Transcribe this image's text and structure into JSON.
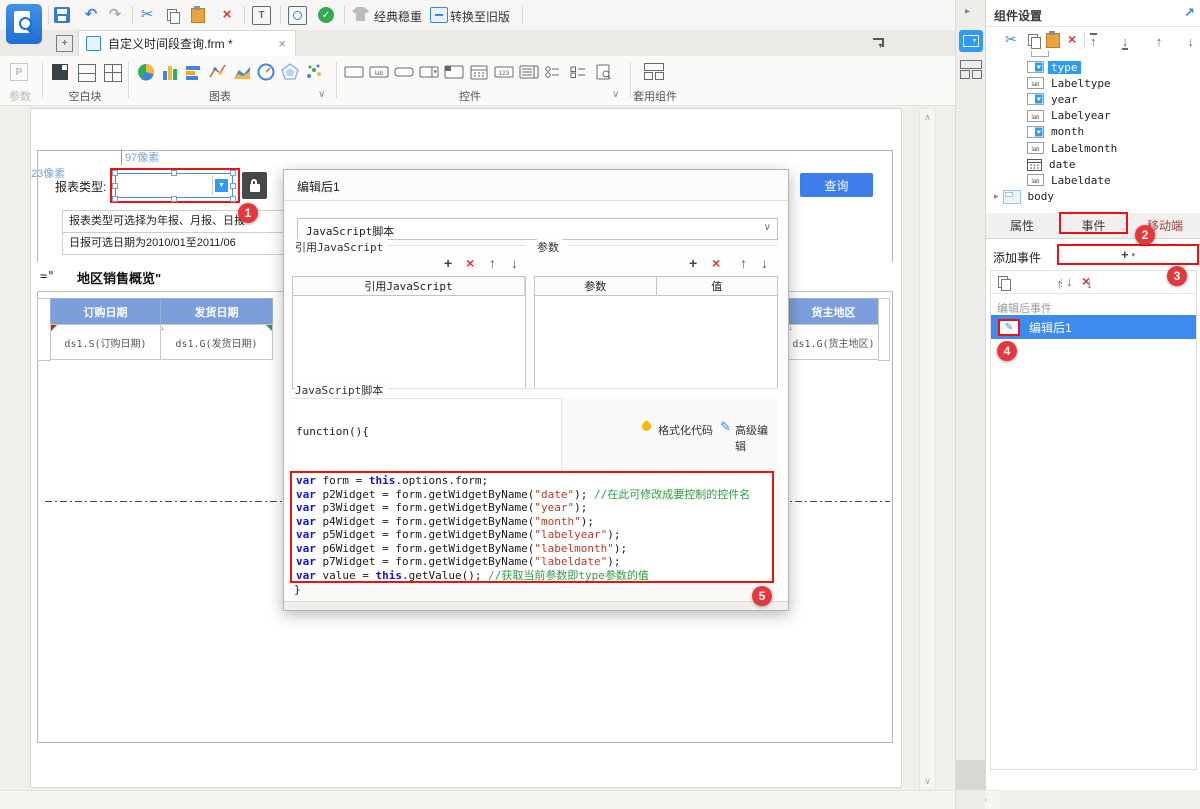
{
  "colors": {
    "accent_blue": "#3d7eea",
    "selection_blue": "#2e9cf4",
    "badge_red": "#e8363d",
    "outline_red": "#ee1111",
    "table_header_blue": "#7c9fdb"
  },
  "glyphs": {
    "undo": "↶",
    "redo": "↷",
    "cut": "✂",
    "close": "×",
    "delete": "×",
    "check": "✓",
    "chevron": "∨",
    "caret_down": "▾",
    "caret_right": "▸",
    "arrow_up": "↑",
    "arrow_down": "↓",
    "plus": "+",
    "pencil": "✎",
    "expand": "↗",
    "combo_caret": "▼",
    "t_letter": "T",
    "p_letter": "P",
    "gt": "›",
    "angle_up": "∧",
    "angle_down": "∨",
    "dots": "⋮"
  },
  "topbar": {
    "classic_label": "经典稳重",
    "convert_label": "转换至旧版"
  },
  "tabbar": {
    "tab_label": "自定义时间段查询.frm *"
  },
  "ribbon": {
    "groups": {
      "param": "参数",
      "blank": "空白块",
      "chart": "图表",
      "widget": "控件",
      "component": "套用组件"
    },
    "chart_icons": [
      {
        "name": "pie-chart-icon",
        "kind": "pie"
      },
      {
        "name": "column-chart-icon",
        "kind": "cols"
      },
      {
        "name": "bar-chart-icon",
        "kind": "hbars"
      },
      {
        "name": "line-chart-icon",
        "kind": "line"
      },
      {
        "name": "area-chart-icon",
        "kind": "area"
      },
      {
        "name": "gauge-chart-icon",
        "kind": "gauge"
      },
      {
        "name": "radar-chart-icon",
        "kind": "radar"
      },
      {
        "name": "scatter-chart-icon",
        "kind": "scatter"
      }
    ],
    "control_icons": [
      {
        "name": "textfield-widget-icon",
        "kind": "text"
      },
      {
        "name": "label-widget-icon",
        "kind": "lab"
      },
      {
        "name": "button-widget-icon",
        "kind": "btn"
      },
      {
        "name": "combobox-widget-icon",
        "kind": "combo"
      },
      {
        "name": "datepane-widget-icon",
        "kind": "datepane"
      },
      {
        "name": "calendar-widget-icon",
        "kind": "cal"
      },
      {
        "name": "number-widget-icon",
        "kind": "num"
      },
      {
        "name": "list-widget-icon",
        "kind": "list"
      },
      {
        "name": "radio-widget-icon",
        "kind": "radio"
      },
      {
        "name": "checkbox-widget-icon",
        "kind": "check"
      },
      {
        "name": "query-widget-icon",
        "kind": "query"
      }
    ]
  },
  "canvas": {
    "ruler_width": "97像素",
    "ruler_height": "23像素",
    "param_label": "报表类型:",
    "query_button": "查询",
    "note1": "报表类型可选择为年报、月报、日报",
    "note2": "日报可选日期为2010/01至2011/06",
    "formula_prefix": "=\"",
    "report_title": "地区销售概览\"",
    "table": {
      "headers": [
        "订购日期",
        "发货日期",
        "货主地区"
      ],
      "cells": [
        "ds1.S(订购日期)",
        "ds1.G(发货日期)",
        "ds1.G(货主地区)"
      ]
    }
  },
  "dialog": {
    "title": "编辑后1",
    "event_type": "JavaScript脚本",
    "refjs_label": "引用JavaScript",
    "refjs_col": "引用JavaScript",
    "param_label": "参数",
    "param_col": "参数",
    "value_col": "值",
    "js_label": "JavaScript脚本",
    "func_open": "function(){",
    "func_close": "}",
    "format_button": "格式化代码",
    "advanced_button": "高级编辑",
    "code_lines": [
      [
        {
          "t": "var ",
          "c": "kw"
        },
        {
          "t": "form = ",
          "c": "pl"
        },
        {
          "t": "this",
          "c": "kw"
        },
        {
          "t": ".options.form;",
          "c": "pl"
        }
      ],
      [
        {
          "t": "var ",
          "c": "kw"
        },
        {
          "t": "p2Widget = form.getWidgetByName(",
          "c": "pl"
        },
        {
          "t": "\"date\"",
          "c": "str"
        },
        {
          "t": "); ",
          "c": "pl"
        },
        {
          "t": "//在此可修改成要控制的控件名",
          "c": "cm"
        }
      ],
      [
        {
          "t": "var ",
          "c": "kw"
        },
        {
          "t": "p3Widget = form.getWidgetByName(",
          "c": "pl"
        },
        {
          "t": "\"year\"",
          "c": "str"
        },
        {
          "t": ");",
          "c": "pl"
        }
      ],
      [
        {
          "t": "var ",
          "c": "kw"
        },
        {
          "t": "p4Widget = form.getWidgetByName(",
          "c": "pl"
        },
        {
          "t": "\"month\"",
          "c": "str"
        },
        {
          "t": ");",
          "c": "pl"
        }
      ],
      [
        {
          "t": "var ",
          "c": "kw"
        },
        {
          "t": "p5Widget = form.getWidgetByName(",
          "c": "pl"
        },
        {
          "t": "\"labelyear\"",
          "c": "str"
        },
        {
          "t": ");",
          "c": "pl"
        }
      ],
      [
        {
          "t": "var ",
          "c": "kw"
        },
        {
          "t": "p6Widget = form.getWidgetByName(",
          "c": "pl"
        },
        {
          "t": "\"labelmonth\"",
          "c": "str"
        },
        {
          "t": ");",
          "c": "pl"
        }
      ],
      [
        {
          "t": "var ",
          "c": "kw"
        },
        {
          "t": "p7Widget = form.getWidgetByName(",
          "c": "pl"
        },
        {
          "t": "\"labeldate\"",
          "c": "str"
        },
        {
          "t": ");",
          "c": "pl"
        }
      ],
      [
        {
          "t": "var ",
          "c": "kw"
        },
        {
          "t": "value = ",
          "c": "pl"
        },
        {
          "t": "this",
          "c": "kw"
        },
        {
          "t": ".getValue(); ",
          "c": "pl"
        },
        {
          "t": "//获取当前参数即type参数的值",
          "c": "cm"
        }
      ]
    ]
  },
  "sidebar": {
    "title": "组件设置",
    "tree": [
      {
        "icon": "combo",
        "label": "type",
        "selected": true
      },
      {
        "icon": "lab",
        "label": "Labeltype"
      },
      {
        "icon": "combo",
        "label": "year"
      },
      {
        "icon": "lab",
        "label": "Labelyear"
      },
      {
        "icon": "combo",
        "label": "month"
      },
      {
        "icon": "lab",
        "label": "Labelmonth"
      },
      {
        "icon": "calendar",
        "label": "date"
      },
      {
        "icon": "lab",
        "label": "Labeldate"
      },
      {
        "icon": "body",
        "label": "body",
        "expand": true
      }
    ],
    "tabs": [
      "属性",
      "事件",
      "移动端"
    ],
    "add_event_label": "添加事件",
    "event_group_label": "编辑后事件",
    "event_item": "编辑后1"
  },
  "badges": [
    "1",
    "2",
    "3",
    "4",
    "5"
  ]
}
